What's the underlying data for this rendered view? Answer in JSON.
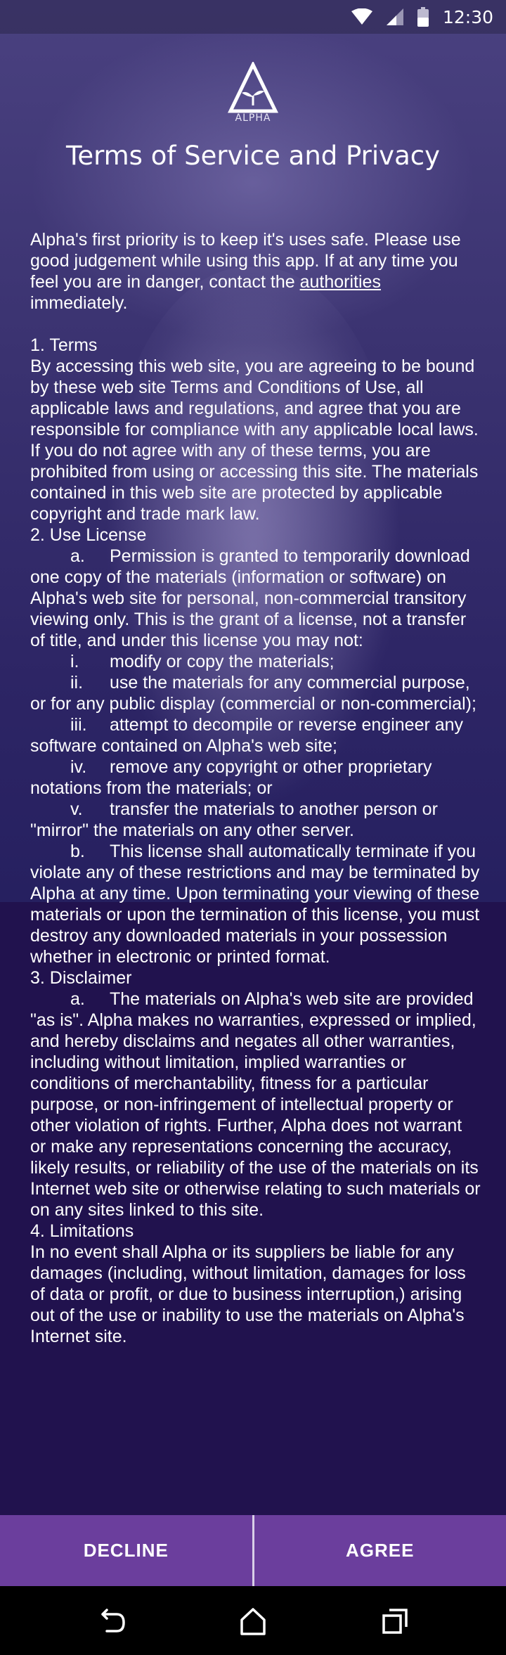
{
  "status_bar": {
    "time": "12:30"
  },
  "logo": {
    "text": "ALPHA"
  },
  "page": {
    "title": "Terms of Service and Privacy"
  },
  "intro": {
    "before_link": "Alpha's first priority is to keep it's uses safe. Please use good judgement while using this app. If at any time you feel you are in danger, contact the ",
    "link": "authorities",
    "after_link": " immediately."
  },
  "sections": {
    "terms_heading": "1. Terms",
    "terms_body": "By accessing this web site, you are agreeing to be bound by these web site Terms and Conditions of Use, all applicable laws and regulations, and agree that you are responsible for compliance with any applicable local laws. If you do not agree with any of these terms, you are prohibited from using or accessing this site. The materials contained in this web site are protected by applicable copyright and trade mark law.",
    "license_heading": "2. Use License",
    "license_a_marker": "a.",
    "license_a": "Permission is granted to temporarily download one copy of the materials (information or software) on Alpha's web site for personal, non-commercial transitory viewing only. This is the grant of a license, not a transfer of title, and under this license you may not:",
    "license_i_marker": "i.",
    "license_i": "modify or copy the materials;",
    "license_ii_marker": "ii.",
    "license_ii": "use the materials for any commercial purpose, or for any public display (commercial or non-commercial);",
    "license_iii_marker": "iii.",
    "license_iii": "attempt to decompile or reverse engineer any software contained on Alpha's web site;",
    "license_iv_marker": "iv.",
    "license_iv": "remove any copyright or other proprietary notations from the materials; or",
    "license_v_marker": "v.",
    "license_v": "transfer the materials to another person or \"mirror\" the materials on any other server.",
    "license_b_marker": "b.",
    "license_b": "This license shall automatically terminate if you violate any of these restrictions and may be terminated by Alpha at any time. Upon terminating your viewing of these materials or upon the termination of this license, you must destroy any downloaded materials in your possession whether in electronic or printed format.",
    "disclaimer_heading": "3. Disclaimer",
    "disclaimer_a_marker": "a.",
    "disclaimer_a": "The materials on Alpha's web site are provided \"as is\". Alpha makes no warranties, expressed or implied, and hereby disclaims and negates all other warranties, including without limitation, implied warranties or conditions of merchantability, fitness for a particular purpose, or non-infringement of intellectual property or other violation of rights. Further, Alpha does not warrant or make any representations concerning the accuracy, likely results, or reliability of the use of the materials on its Internet web site or otherwise relating to such materials or on any sites linked to this site.",
    "limitations_heading": "4. Limitations",
    "limitations_body": "In no event shall Alpha or its suppliers be liable for any damages (including, without limitation, damages for loss of data or profit, or due to business interruption,) arising out of the use or inability to use the materials on Alpha's Internet site."
  },
  "buttons": {
    "decline": "DECLINE",
    "agree": "AGREE"
  },
  "icons": {
    "status": [
      "wifi-icon",
      "signal-icon",
      "battery-icon"
    ],
    "nav": [
      "back-icon",
      "home-icon",
      "recents-icon"
    ]
  },
  "colors": {
    "button_bg": "#6b3e9d",
    "background": "#21124e",
    "divider": "#d9cfe8"
  }
}
